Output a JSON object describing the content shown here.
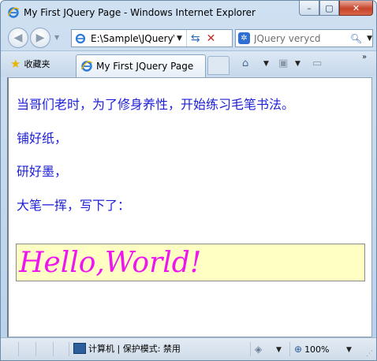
{
  "window": {
    "title": "My First JQuery Page - Windows Internet Explorer",
    "controls": {
      "minimize": "–",
      "maximize": "▢",
      "close": "✕"
    }
  },
  "navigation": {
    "address": "E:\\Sample\\JQuery\\",
    "search_text": "JQuery verycd",
    "search_provider": "✲"
  },
  "tabs": {
    "favorites_label": "收藏夹",
    "active_tab_title": "My First JQuery Page"
  },
  "icons": {
    "back": "back-arrow-icon",
    "forward": "forward-arrow-icon",
    "refresh": "refresh-icon",
    "stop": "stop-icon",
    "search_go": "magnifier-icon",
    "home": "home-icon",
    "feeds": "feeds-icon",
    "print": "print-icon",
    "zone": "computer-zone-icon",
    "zoom": "zoom-icon"
  },
  "content": {
    "lines": [
      "当哥们老时，为了修身养性，开始练习毛笔书法。",
      "铺好纸，",
      "研好墨，",
      "大笔一挥，写下了："
    ],
    "hello": "Hello,World!",
    "text_color": "#1d1fd6",
    "hello_color": "#ee15ee",
    "hello_background": "#ffffc4"
  },
  "statusbar": {
    "zone_text": "计算机 | 保护模式: 禁用",
    "zoom_text": "100%"
  }
}
